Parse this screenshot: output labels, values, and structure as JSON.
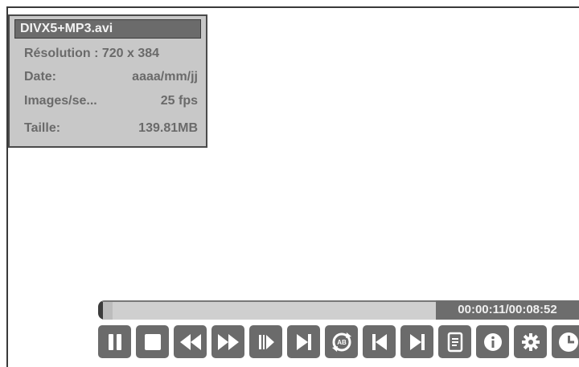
{
  "file_info": {
    "filename": "DIVX5+MP3.avi",
    "resolution": "Résolution : 720 x 384",
    "date_label": "Date:",
    "date_value": "aaaa/mm/jj",
    "fps_label": "Images/se...",
    "fps_value": "25 fps",
    "size_label": "Taille:",
    "size_value": "139.81MB"
  },
  "playback": {
    "time": "00:00:11/00:08:52",
    "progress_fraction": 0.02
  },
  "controls": [
    {
      "name": "pause-button",
      "icon": "pause-icon"
    },
    {
      "name": "stop-button",
      "icon": "stop-icon"
    },
    {
      "name": "rewind-button",
      "icon": "rewind-icon"
    },
    {
      "name": "fast-forward-button",
      "icon": "fast-forward-icon"
    },
    {
      "name": "slow-forward-button",
      "icon": "slow-forward-icon"
    },
    {
      "name": "step-forward-button",
      "icon": "step-forward-icon"
    },
    {
      "name": "repeat-ab-button",
      "icon": "repeat-ab-icon"
    },
    {
      "name": "previous-button",
      "icon": "previous-icon"
    },
    {
      "name": "next-button",
      "icon": "next-icon"
    },
    {
      "name": "playlist-button",
      "icon": "playlist-icon"
    },
    {
      "name": "info-button",
      "icon": "info-icon"
    },
    {
      "name": "settings-button",
      "icon": "gear-icon"
    },
    {
      "name": "timer-button",
      "icon": "clock-icon"
    }
  ],
  "colors": {
    "panel_bg": "#c8c8c8",
    "button_bg": "#6b6b6b",
    "icon_fg": "#ffffff"
  }
}
